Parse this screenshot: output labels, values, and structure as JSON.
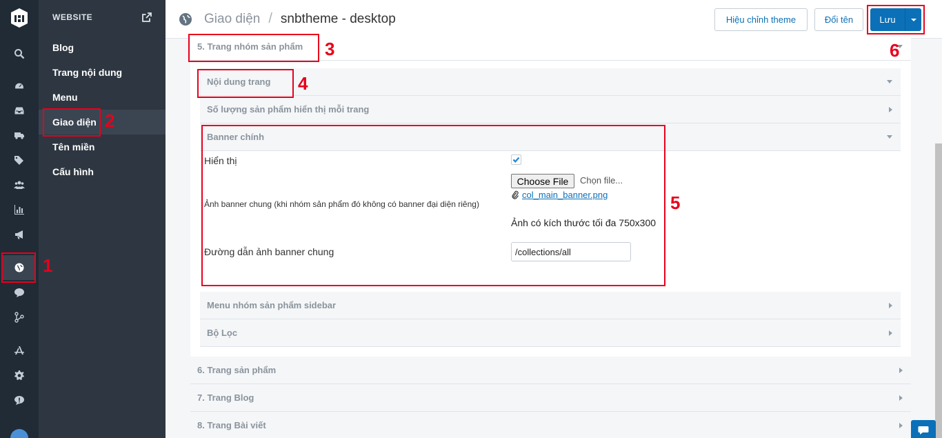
{
  "sidebar": {
    "section_title": "WEBSITE",
    "items": [
      {
        "label": "Blog"
      },
      {
        "label": "Trang nội dung"
      },
      {
        "label": "Menu"
      },
      {
        "label": "Giao diện",
        "active": true
      },
      {
        "label": "Tên miền"
      },
      {
        "label": "Cấu hình"
      }
    ]
  },
  "header": {
    "section": "Giao diện",
    "separator": "/",
    "theme_name": "snbtheme - desktop",
    "buttons": {
      "edit_theme": "Hiệu chỉnh theme",
      "rename": "Đổi tên",
      "save": "Lưu"
    }
  },
  "sections": {
    "s5": "5. Trang nhóm sản phẩm",
    "content": "Nội dung trang",
    "products_per_page": "Số lượng sản phẩm hiển thị mỗi trang",
    "banner": "Banner chính",
    "sidebar_menu": "Menu nhóm sản phẩm sidebar",
    "filter": "Bộ Lọc",
    "s6": "6. Trang sản phẩm",
    "s7": "7. Trang Blog",
    "s8": "8. Trang Bài viết"
  },
  "banner_form": {
    "show_label": "Hiển thị",
    "show_checked": true,
    "image_label": "Ảnh banner chung (khi nhóm sản phẩm đó không có banner đại diện riêng)",
    "choose_file": "Choose File",
    "file_status": "Chọn file...",
    "file_name": "col_main_banner.png",
    "size_hint": "Ảnh có kích thước tối đa 750x300",
    "link_label": "Đường dẫn ảnh banner chung",
    "link_value": "/collections/all"
  },
  "annotations": [
    "1",
    "2",
    "3",
    "4",
    "5",
    "6"
  ],
  "colors": {
    "rail_bg": "#202b36",
    "nav_bg": "#2e3741",
    "accent": "#0b70b8",
    "annotation": "#e8001c"
  }
}
